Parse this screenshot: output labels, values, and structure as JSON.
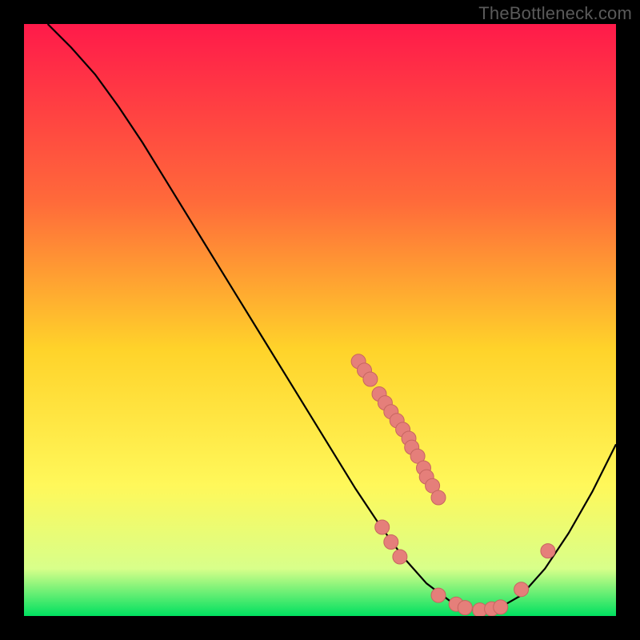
{
  "watermark": "TheBottleneck.com",
  "colors": {
    "background": "#000000",
    "gradient_top": "#ff1a4a",
    "gradient_mid1": "#ff6a3a",
    "gradient_mid2": "#ffd32a",
    "gradient_mid3": "#fff85a",
    "gradient_mid4": "#d8ff8a",
    "gradient_bottom": "#00e060",
    "curve": "#000000",
    "point_fill": "#e57f7a",
    "point_stroke": "#c76560"
  },
  "chart_data": {
    "type": "line",
    "title": "",
    "xlabel": "",
    "ylabel": "",
    "xlim": [
      0,
      100
    ],
    "ylim": [
      0,
      100
    ],
    "curve": [
      {
        "x": 4,
        "y": 100
      },
      {
        "x": 8,
        "y": 96
      },
      {
        "x": 12,
        "y": 91.5
      },
      {
        "x": 16,
        "y": 86
      },
      {
        "x": 20,
        "y": 80
      },
      {
        "x": 24,
        "y": 73.5
      },
      {
        "x": 28,
        "y": 67
      },
      {
        "x": 32,
        "y": 60.5
      },
      {
        "x": 36,
        "y": 54
      },
      {
        "x": 40,
        "y": 47.5
      },
      {
        "x": 44,
        "y": 41
      },
      {
        "x": 48,
        "y": 34.5
      },
      {
        "x": 52,
        "y": 28
      },
      {
        "x": 56,
        "y": 21.5
      },
      {
        "x": 60,
        "y": 15.5
      },
      {
        "x": 64,
        "y": 10
      },
      {
        "x": 68,
        "y": 5.5
      },
      {
        "x": 72,
        "y": 2.5
      },
      {
        "x": 76,
        "y": 1
      },
      {
        "x": 80,
        "y": 1.2
      },
      {
        "x": 84,
        "y": 3.5
      },
      {
        "x": 88,
        "y": 8
      },
      {
        "x": 92,
        "y": 14
      },
      {
        "x": 96,
        "y": 21
      },
      {
        "x": 100,
        "y": 29
      }
    ],
    "series": [
      {
        "name": "cluster_descending",
        "points": [
          {
            "x": 56.5,
            "y": 43
          },
          {
            "x": 57.5,
            "y": 41.5
          },
          {
            "x": 58.5,
            "y": 40
          },
          {
            "x": 60,
            "y": 37.5
          },
          {
            "x": 61,
            "y": 36
          },
          {
            "x": 62,
            "y": 34.5
          },
          {
            "x": 63,
            "y": 33
          },
          {
            "x": 64,
            "y": 31.5
          },
          {
            "x": 65,
            "y": 30
          },
          {
            "x": 65.5,
            "y": 28.5
          },
          {
            "x": 66.5,
            "y": 27
          },
          {
            "x": 67.5,
            "y": 25
          },
          {
            "x": 68,
            "y": 23.5
          },
          {
            "x": 69,
            "y": 22
          },
          {
            "x": 70,
            "y": 20
          }
        ]
      },
      {
        "name": "cluster_descending_lower",
        "points": [
          {
            "x": 60.5,
            "y": 15
          },
          {
            "x": 62,
            "y": 12.5
          },
          {
            "x": 63.5,
            "y": 10
          }
        ]
      },
      {
        "name": "cluster_valley",
        "points": [
          {
            "x": 70,
            "y": 3.5
          },
          {
            "x": 73,
            "y": 2
          },
          {
            "x": 74.5,
            "y": 1.4
          },
          {
            "x": 77,
            "y": 1
          },
          {
            "x": 79,
            "y": 1.2
          },
          {
            "x": 80.5,
            "y": 1.5
          }
        ]
      },
      {
        "name": "cluster_ascending",
        "points": [
          {
            "x": 84,
            "y": 4.5
          },
          {
            "x": 88.5,
            "y": 11
          }
        ]
      }
    ]
  }
}
